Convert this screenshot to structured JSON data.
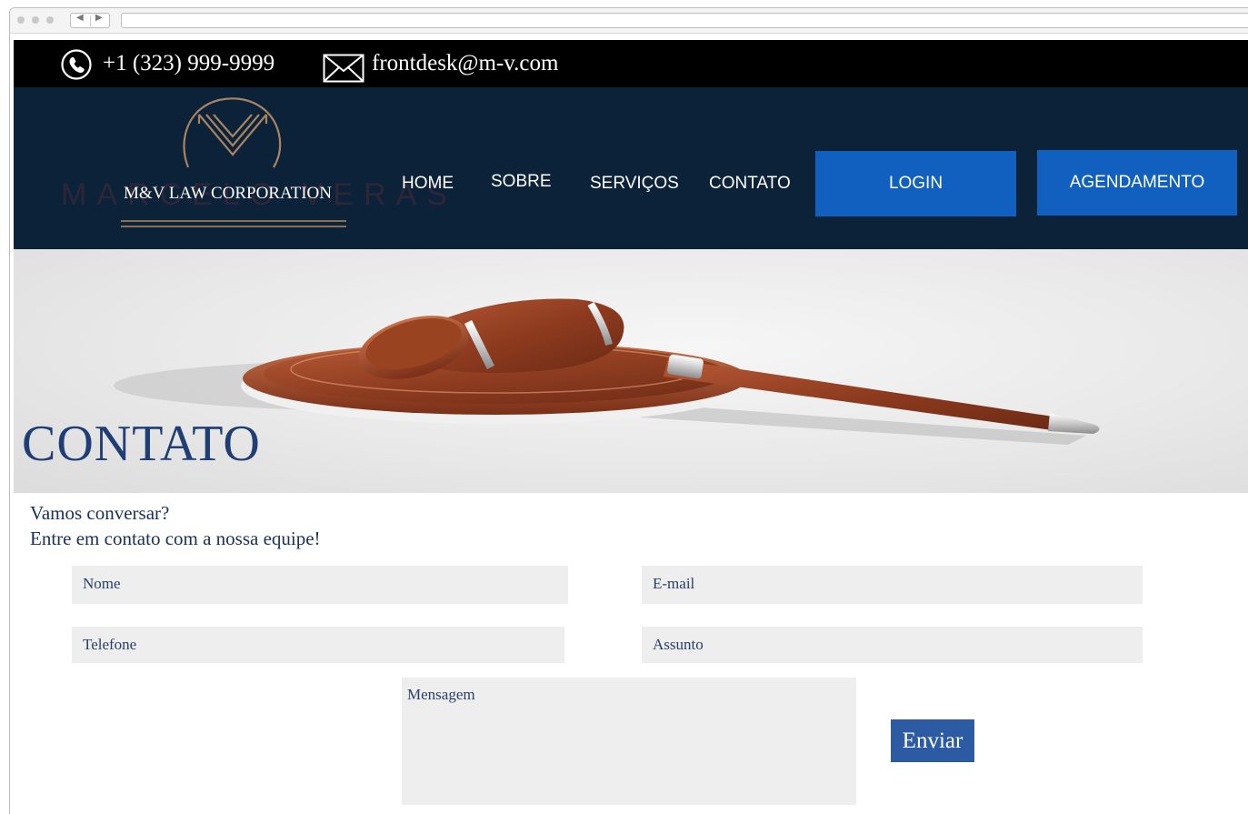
{
  "topbar": {
    "phone": "+1 (323) 999-9999",
    "email": "frontdesk@m-v.com"
  },
  "header": {
    "logo_text": "M&V LAW CORPORATION",
    "watermark": "MARCELO VERAS",
    "nav": [
      "HOME",
      "SOBRE",
      "SERVIÇOS",
      "CONTATO"
    ],
    "login_label": "LOGIN",
    "schedule_label": "AGENDAMENTO"
  },
  "hero": {
    "title": "CONTATO"
  },
  "intro": {
    "line1": "Vamos conversar?",
    "line2": "Entre em contato com a nossa equipe!"
  },
  "form": {
    "name_placeholder": "Nome",
    "email_placeholder": "E-mail",
    "phone_placeholder": "Telefone",
    "subject_placeholder": "Assunto",
    "message_placeholder": "Mensagem",
    "submit_label": "Enviar"
  },
  "colors": {
    "header_bg": "#0b2239",
    "button_blue": "#1160c0",
    "title_blue": "#1e3e75",
    "submit_blue": "#2d5ba3"
  },
  "icons": [
    "phone-icon",
    "mail-icon",
    "logo-m-icon"
  ]
}
